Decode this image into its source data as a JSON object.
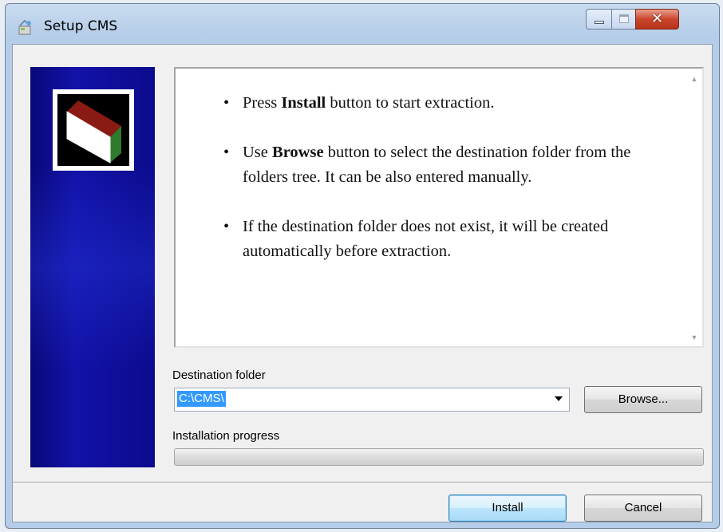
{
  "window": {
    "title": "Setup CMS",
    "controls": {
      "minimize_icon": "minimize-icon",
      "maximize_icon": "maximize-icon",
      "close_label": "✕"
    }
  },
  "side_panel": {
    "logo_icon": "box-logo-icon",
    "background_color": "#0c0a8c"
  },
  "instructions": {
    "items": [
      {
        "pre": "Press ",
        "bold": "Install",
        "post": " button to start extraction."
      },
      {
        "pre": "Use ",
        "bold": "Browse",
        "post": " button to select the destination folder from the folders tree. It can be also entered manually."
      },
      {
        "pre": "",
        "bold": "",
        "post": "If the destination folder does not exist, it will be created automatically before extraction."
      }
    ]
  },
  "destination": {
    "label": "Destination folder",
    "value": "C:\\CMS\\",
    "browse_label": "Browse..."
  },
  "progress": {
    "label": "Installation progress",
    "value": 0
  },
  "footer": {
    "install_label": "Install",
    "cancel_label": "Cancel"
  },
  "colors": {
    "selection": "#3399ff",
    "close_button": "#c9462c"
  }
}
